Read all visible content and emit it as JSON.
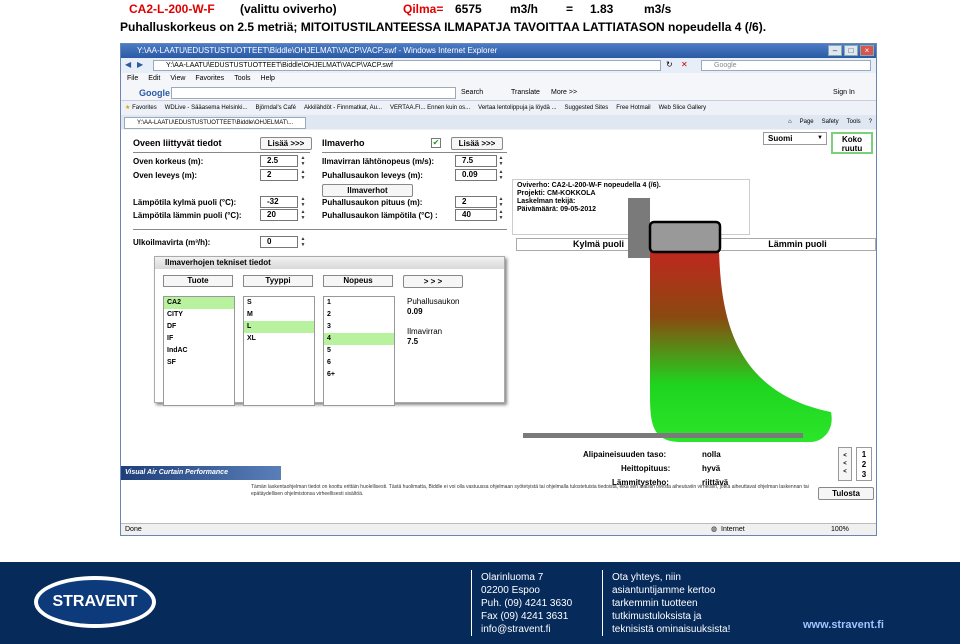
{
  "header": {
    "model": "CA2-L-200-W-F",
    "selected": "(valittu oviverho)",
    "airflow_label": "Qilma=",
    "airflow_m3h": "6575",
    "unit_m3h": "m3/h",
    "eq": "=",
    "airflow_m3s": "1.83",
    "unit_m3s": "m3/s",
    "subtitle": "Puhalluskorkeus on 2.5 metriä; MITOITUSTILANTEESSA ILMAPATJA  TAVOITTAA LATTIATASON nopeudella 4 (/6)."
  },
  "browser": {
    "title": "Y:\\AA-LAATU\\EDUSTUSTUOTTEET\\Biddle\\OHJELMAT\\VACP\\VACP.swf - Windows Internet Explorer",
    "address": "Y:\\AA-LAATU\\EDUSTUSTUOTTEET\\Biddle\\OHJELMAT\\VACP\\VACP.swf",
    "search_placeholder": "Google",
    "menu": [
      "File",
      "Edit",
      "View",
      "Favorites",
      "Tools",
      "Help"
    ],
    "google_label": "Google",
    "search_btn": "Search",
    "translate_btn": "Translate",
    "more_btn": "More >>",
    "signin": "Sign In",
    "favorites_label": "Favorites",
    "favorites": [
      "WDLive - Sääasema Helsinki...",
      "Björndal's Café",
      "Akkilähdöt - Finnmatkat, Au...",
      "VERTAA.FI... Ennen kuin os...",
      "Vertaa lentolippuja ja löydä ...",
      "Suggested Sites",
      "Free Hotmail",
      "Web Slice Gallery"
    ],
    "tab_title": "Y:\\AA-LAATU\\EDUSTUSTUOTTEET\\Biddle\\OHJELMAT\\...",
    "page_menu": "Page",
    "safety_menu": "Safety",
    "tools_menu": "Tools",
    "status_left": "Done",
    "status_zone": "Internet",
    "zoom": "100%"
  },
  "app": {
    "door_heading": "Oveen liittyvät tiedot",
    "more_btn": "Lisää >>>",
    "curtain_heading": "Ilmaverho",
    "door_height_label": "Oven korkeus (m):",
    "door_height": "2.5",
    "door_width_label": "Oven leveys (m):",
    "door_width": "2",
    "outlet_speed_label": "Ilmavirran lähtönopeus (m/s):",
    "outlet_speed": "7.5",
    "nozzle_width_label": "Puhallusaukon leveys (m):",
    "nozzle_width": "0.09",
    "curtains_btn": "Ilmaverhot",
    "temp_cold_label": "Lämpötila kylmä puoli (°C):",
    "temp_cold": "-32",
    "temp_warm_label": "Lämpötila lämmin puoli (°C):",
    "temp_warm": "20",
    "nozzle_length_label": "Puhallusaukon pituus (m):",
    "nozzle_length": "2",
    "nozzle_temp_label": "Puhallusaukon lämpötila (°C) :",
    "nozzle_temp": "40",
    "outdoor_flow_label": "Ulkoilmavirta (m³/h):",
    "outdoor_flow": "0",
    "info": {
      "line1": "Oviverho: CA2-L-200-W-F  nopeudella 4 (/6).",
      "line2": "Projekti: CM-KOKKOLA",
      "line3": "Laskelman tekijä:",
      "line4": "Päivämäärä: 09-05-2012"
    },
    "language": "Suomi",
    "fullscreen_btn": "Koko ruutu",
    "cold_side": "Kylmä puoli",
    "warm_side": "Lämmin puoli",
    "tech_title": "Ilmaverhojen tekniset tiedot",
    "col_product": "Tuote",
    "col_type": "Tyyppi",
    "col_speed": "Nopeus",
    "next_btn": "> > >",
    "products": [
      "CA2",
      "CITY",
      "DF",
      "IF",
      "IndAC",
      "SF"
    ],
    "types": [
      "S",
      "M",
      "L",
      "XL"
    ],
    "speeds": [
      "1",
      "2",
      "3",
      "4",
      "5",
      "6",
      "6+"
    ],
    "nozzle_label": "Puhallusaukon",
    "nozzle_value": "0.09",
    "flow_label": "Ilmavirran",
    "flow_value": "7.5",
    "brand_text": "Visual Air Curtain Performance",
    "disclaimer": "Tämän laskentaohjelman tiedot on koottu erittäin huolellisesti. Tästä huolimatta, Biddle ei voi olla vastuussa ohjelmaan syötetyistä tai ohjelmalla tulostetuista tiedoista, eikä sen alaisiin ovesta aiheutuviin virheisiin, jotka aiheuttavat ohjelman laskennan tai epätäydellisen ohjelmistonsa virheellisesti sisältöä.",
    "underpressure_label": "Alipaineisuuden taso:",
    "underpressure_value": "nolla",
    "throw_label": "Heittopituus:",
    "throw_value": "hyvä",
    "heating_label": "Lämmitysteho:",
    "heating_value": "riittävä",
    "nav_up": "<<<",
    "nav_pages": [
      "1",
      "2",
      "3"
    ],
    "print_btn": "Tulosta"
  },
  "footer": {
    "brand": "STRAVENT",
    "addr": [
      "Olarinluoma 7",
      "02200 Espoo",
      "Puh. (09) 4241 3630",
      "Fax (09) 4241 3631",
      "info@stravent.fi"
    ],
    "contact": [
      "Ota yhteys, niin",
      "asiantuntijamme kertoo",
      "tarkemmin tuotteen",
      "tutkimustuloksista ja",
      "teknisistä ominaisuuksista!"
    ],
    "web": "www.stravent.fi"
  }
}
